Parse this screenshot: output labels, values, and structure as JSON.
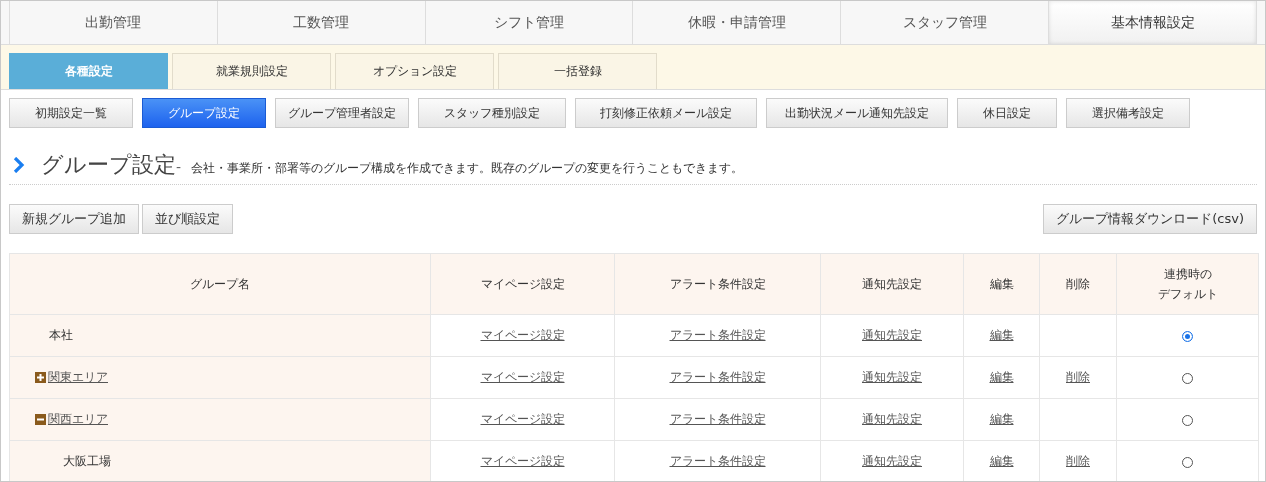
{
  "main_tabs": [
    {
      "label": "出勤管理",
      "selected": false
    },
    {
      "label": "工数管理",
      "selected": false
    },
    {
      "label": "シフト管理",
      "selected": false
    },
    {
      "label": "休暇・申請管理",
      "selected": false
    },
    {
      "label": "スタッフ管理",
      "selected": false
    },
    {
      "label": "基本情報設定",
      "selected": true
    }
  ],
  "sub_tabs": [
    {
      "label": "各種設定",
      "selected": true
    },
    {
      "label": "就業規則設定",
      "selected": false
    },
    {
      "label": "オプション設定",
      "selected": false
    },
    {
      "label": "一括登録",
      "selected": false
    }
  ],
  "setting_buttons": [
    {
      "label": "初期設定一覧",
      "selected": false
    },
    {
      "label": "グループ設定",
      "selected": true
    },
    {
      "label": "グループ管理者設定",
      "selected": false
    },
    {
      "label": "スタッフ種別設定",
      "selected": false
    },
    {
      "label": "打刻修正依頼メール設定",
      "selected": false
    },
    {
      "label": "出勤状況メール通知先設定",
      "selected": false
    },
    {
      "label": "休日設定",
      "selected": false
    },
    {
      "label": "選択備考設定",
      "selected": false
    }
  ],
  "heading": {
    "title": "グループ設定",
    "dash": "-",
    "description": "会社・事業所・部署等のグループ構成を作成できます。既存のグループの変更を行うこともできます。"
  },
  "actions": [
    "新規グループ追加",
    "並び順設定"
  ],
  "download_button": "グループ情報ダウンロード(csv)",
  "table": {
    "columns": [
      {
        "lines": [
          "グループ名"
        ]
      },
      {
        "lines": [
          "マイページ設定"
        ]
      },
      {
        "lines": [
          "アラート条件設定"
        ]
      },
      {
        "lines": [
          "通知先設定"
        ]
      },
      {
        "lines": [
          "編集"
        ]
      },
      {
        "lines": [
          "削除"
        ]
      },
      {
        "lines": [
          "連携時の",
          "デフォルト"
        ]
      }
    ],
    "rows": [
      {
        "name": "本社",
        "mypage": "マイページ設定",
        "alert": "アラート条件設定",
        "notify": "通知先設定",
        "edit": "編集",
        "default_selected": true
      },
      {
        "name": "関東エリア",
        "expanded": false,
        "mypage": "マイページ設定",
        "alert": "アラート条件設定",
        "notify": "通知先設定",
        "edit": "編集",
        "delete": "削除",
        "default_selected": false
      },
      {
        "name": "関西エリア",
        "expanded": true,
        "mypage": "マイページ設定",
        "alert": "アラート条件設定",
        "notify": "通知先設定",
        "edit": "編集",
        "default_selected": false,
        "children": [
          {
            "name": "大阪工場",
            "mypage": "マイページ設定",
            "alert": "アラート条件設定",
            "notify": "通知先設定",
            "edit": "編集",
            "delete": "削除",
            "default_selected": false
          }
        ]
      }
    ]
  }
}
